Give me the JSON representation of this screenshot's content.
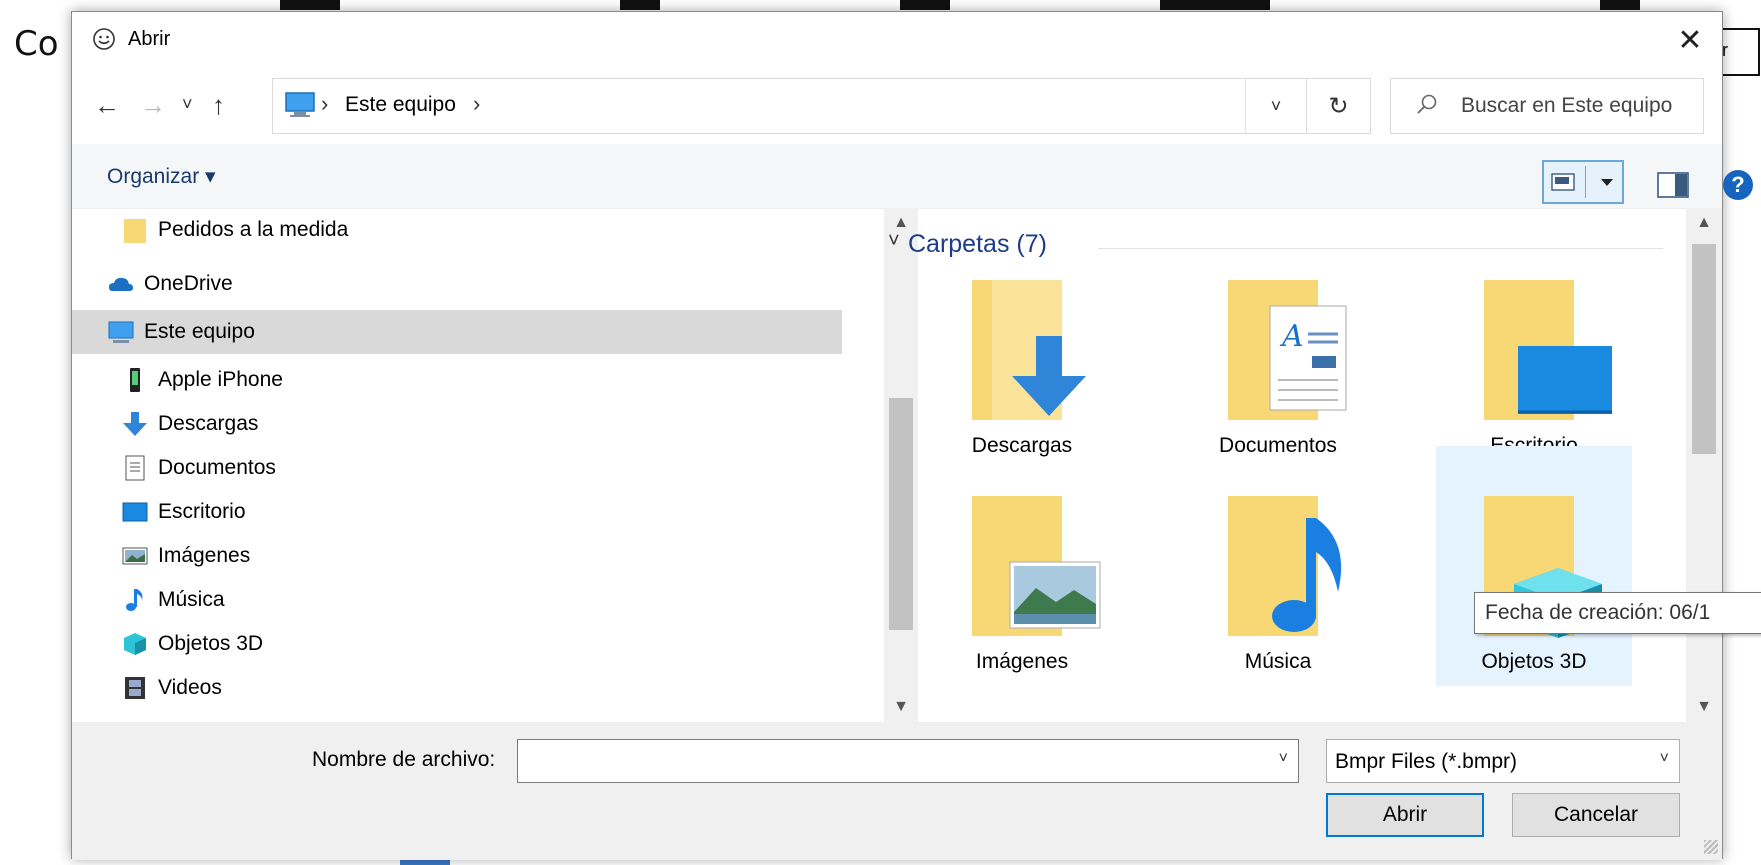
{
  "background": {
    "left_text": "Co",
    "right_text": "r"
  },
  "dialog": {
    "title": "Abrir",
    "close_glyph": "✕",
    "nav": {
      "back": "←",
      "forward": "→",
      "recent": "˅",
      "up": "↑"
    },
    "address": {
      "location": "Este equipo",
      "sep1": "›",
      "sep2": "›",
      "dropdown": "˅"
    },
    "refresh_glyph": "↻",
    "search": {
      "placeholder": "Buscar en Este equipo"
    },
    "toolbar": {
      "organize": "Organizar ▾",
      "help": "?"
    },
    "nav_pane": {
      "items": [
        {
          "label": "Pedidos a la medida",
          "icon": "folder-icon"
        },
        {
          "label": "OneDrive",
          "icon": "cloud-icon"
        },
        {
          "label": "Este equipo",
          "icon": "computer-icon",
          "selected": true
        },
        {
          "label": "Apple iPhone",
          "icon": "phone-icon"
        },
        {
          "label": "Descargas",
          "icon": "download-arrow-icon"
        },
        {
          "label": "Documentos",
          "icon": "document-icon"
        },
        {
          "label": "Escritorio",
          "icon": "desktop-icon"
        },
        {
          "label": "Imágenes",
          "icon": "pictures-icon"
        },
        {
          "label": "Música",
          "icon": "music-note-icon"
        },
        {
          "label": "Objetos 3D",
          "icon": "cube-3d-icon"
        },
        {
          "label": "Videos",
          "icon": "film-icon"
        }
      ]
    },
    "content": {
      "group_header": "Carpetas (7)",
      "folders": [
        {
          "label": "Descargas",
          "icon": "downloads-folder-icon"
        },
        {
          "label": "Documentos",
          "icon": "documents-folder-icon"
        },
        {
          "label": "Escritorio",
          "icon": "desktop-folder-icon"
        },
        {
          "label": "Imágenes",
          "icon": "pictures-folder-icon"
        },
        {
          "label": "Música",
          "icon": "music-folder-icon"
        },
        {
          "label": "Objetos 3D",
          "icon": "objects3d-folder-icon",
          "hovered": true
        }
      ],
      "tooltip": "Fecha de creación: 06/1"
    },
    "bottom": {
      "filename_label": "Nombre de archivo:",
      "filename_value": "",
      "filetype": "Bmpr Files (*.bmpr)",
      "open_button": "Abrir",
      "cancel_button": "Cancelar"
    },
    "colors": {
      "accent": "#0078d7",
      "header_blue": "#1e3b8a",
      "folder_yellow": "#f8d775",
      "hover_bg": "#e5f3ff",
      "selection_bg": "#d9d9d9"
    }
  }
}
